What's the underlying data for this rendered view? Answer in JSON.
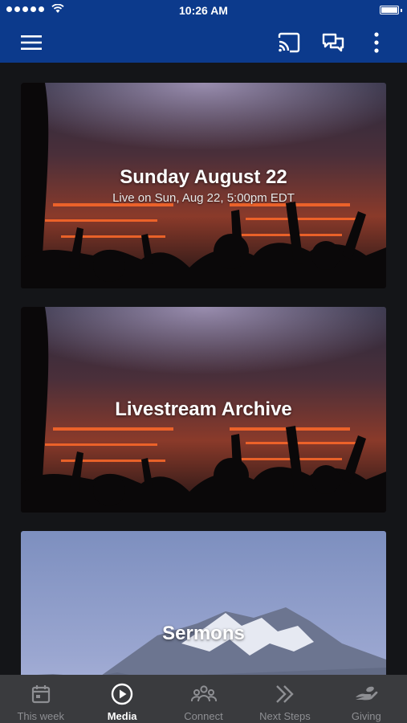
{
  "status_bar": {
    "time": "10:26 AM"
  },
  "app_bar": {
    "icons": [
      "menu-icon",
      "cast-icon",
      "chat-icon",
      "more-vertical-icon"
    ]
  },
  "cards": [
    {
      "title": "Sunday August 22",
      "subtitle": "Live on Sun, Aug 22, 5:00pm EDT"
    },
    {
      "title": "Livestream Archive"
    },
    {
      "title": "Sermons"
    }
  ],
  "tabs": [
    {
      "label": "This week",
      "icon": "calendar-icon",
      "active": false
    },
    {
      "label": "Media",
      "icon": "play-circle-icon",
      "active": true
    },
    {
      "label": "Connect",
      "icon": "people-icon",
      "active": false
    },
    {
      "label": "Next Steps",
      "icon": "double-chevron-icon",
      "active": false
    },
    {
      "label": "Giving",
      "icon": "giving-hand-icon",
      "active": false
    }
  ],
  "colors": {
    "brand_bar": "#0c3a8c",
    "content_bg": "#141518",
    "tab_bar_bg": "#3a3b3e",
    "tab_inactive": "#8e8f93",
    "tab_active": "#ffffff"
  }
}
